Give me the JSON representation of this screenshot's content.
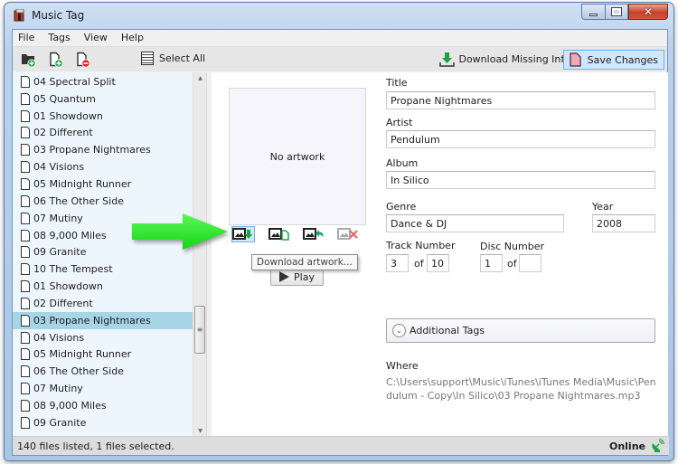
{
  "window": {
    "title": "Music Tag",
    "minimize_label": "minimize",
    "maximize_label": "maximize",
    "close_label": "close"
  },
  "menu": {
    "items": [
      "File",
      "Tags",
      "View",
      "Help"
    ]
  },
  "toolbar": {
    "add_folder_icon": "folder-add-icon",
    "add_file_icon": "file-add-icon",
    "remove_file_icon": "file-remove-icon",
    "select_all_label": "Select All",
    "download_missing_label": "Download Missing Info",
    "save_changes_label": "Save Changes"
  },
  "file_list": {
    "items": [
      {
        "name": "04 Spectral Split",
        "selected": false
      },
      {
        "name": "05 Quantum",
        "selected": false
      },
      {
        "name": "01 Showdown",
        "selected": false
      },
      {
        "name": "02 Different",
        "selected": false
      },
      {
        "name": "03 Propane Nightmares",
        "selected": false
      },
      {
        "name": "04 Visions",
        "selected": false
      },
      {
        "name": "05 Midnight Runner",
        "selected": false
      },
      {
        "name": "06 The Other Side",
        "selected": false
      },
      {
        "name": "07 Mutiny",
        "selected": false
      },
      {
        "name": "08 9,000 Miles",
        "selected": false
      },
      {
        "name": "09 Granite",
        "selected": false
      },
      {
        "name": "10 The Tempest",
        "selected": false
      },
      {
        "name": "01 Showdown",
        "selected": false
      },
      {
        "name": "02 Different",
        "selected": false
      },
      {
        "name": "03 Propane Nightmares",
        "selected": true
      },
      {
        "name": "04 Visions",
        "selected": false
      },
      {
        "name": "05 Midnight Runner",
        "selected": false
      },
      {
        "name": "06 The Other Side",
        "selected": false
      },
      {
        "name": "07 Mutiny",
        "selected": false
      },
      {
        "name": "08 9,000 Miles",
        "selected": false
      },
      {
        "name": "09 Granite",
        "selected": false
      }
    ]
  },
  "artwork": {
    "placeholder": "No artwork",
    "buttons": [
      "Download artwork",
      "Add artwork from file",
      "Restore artwork",
      "Remove artwork"
    ],
    "tooltip": "Download artwork...",
    "play_label": "Play"
  },
  "tags": {
    "title_label": "Title",
    "title_value": "Propane Nightmares",
    "artist_label": "Artist",
    "artist_value": "Pendulum",
    "album_label": "Album",
    "album_value": "In Silico",
    "genre_label": "Genre",
    "genre_value": "Dance & DJ",
    "year_label": "Year",
    "year_value": "2008",
    "track_label": "Track Number",
    "track_value": "3",
    "track_total": "10",
    "disc_label": "Disc Number",
    "disc_value": "1",
    "disc_total": "",
    "of_label": "of",
    "additional_tags_label": "Additional Tags",
    "where_label": "Where",
    "where_value": "C:\\Users\\support\\Music\\iTunes\\iTunes Media\\Music\\Pendulum - Copy\\In Silico\\03 Propane Nightmares.mp3"
  },
  "status": {
    "files_text": "140 files listed, 1 files selected.",
    "online_label": "Online"
  },
  "colors": {
    "accent_green": "#22dd22",
    "selection": "#a8d5e6",
    "save_button_bg": "#cfe6fb"
  }
}
